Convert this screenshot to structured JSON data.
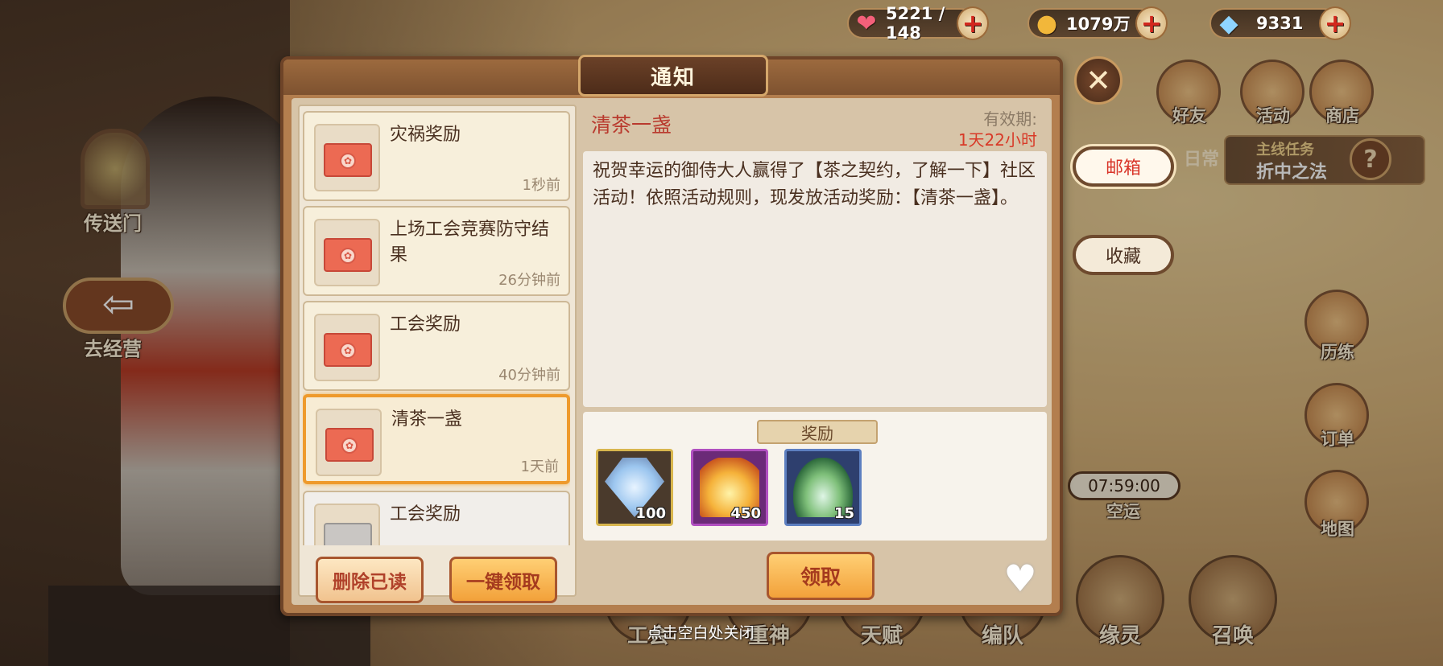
{
  "resources": {
    "stamina": "5221 / 148",
    "gold": "1079万",
    "diamond": "9331"
  },
  "side": {
    "portal_label": "传送门",
    "back_label": "去经营"
  },
  "right_menu": {
    "items": [
      "邮箱",
      "好友",
      "活动",
      "商店"
    ],
    "daily": "日常",
    "quest_title": "主线任务",
    "quest_name": "折中之法",
    "train": "历练",
    "orders": "订单",
    "map": "地图",
    "timer": "07:59:00",
    "airship": "空运",
    "mail_tab": "邮箱",
    "fav_tab": "收藏"
  },
  "dialog": {
    "title": "通知",
    "mails": [
      {
        "title": "灾祸奖励",
        "time": "1秒前"
      },
      {
        "title": "上场工会竞赛防守结果",
        "time": "26分钟前"
      },
      {
        "title": "工会奖励",
        "time": "40分钟前"
      },
      {
        "title": "清茶一盏",
        "time": "1天前"
      },
      {
        "title": "工会奖励",
        "time": ""
      }
    ],
    "delete_read": "删除已读",
    "claim_all": "一键领取",
    "detail": {
      "subject": "清茶一盏",
      "valid_label": "有效期:",
      "valid_time": "1天22小时",
      "body": "祝贺幸运的御侍大人赢得了【茶之契约，了解一下】社区活动！依照活动规则，现发放活动奖励：【清茶一盏】。",
      "reward_tag": "奖励",
      "rewards": [
        {
          "name": "diamond",
          "qty": "100"
        },
        {
          "name": "fire-essence",
          "qty": "450"
        },
        {
          "name": "tea-leaf",
          "qty": "15"
        }
      ],
      "claim": "领取"
    }
  },
  "bottom": {
    "labels": [
      "工会",
      "重神",
      "天赋",
      "编队",
      "缘灵",
      "召唤"
    ],
    "close_hint": "点击空白处关闭"
  },
  "colors": {
    "accent_orange": "#f2a13a",
    "title_red": "#b93a2e",
    "valid_red": "#d83a28"
  }
}
